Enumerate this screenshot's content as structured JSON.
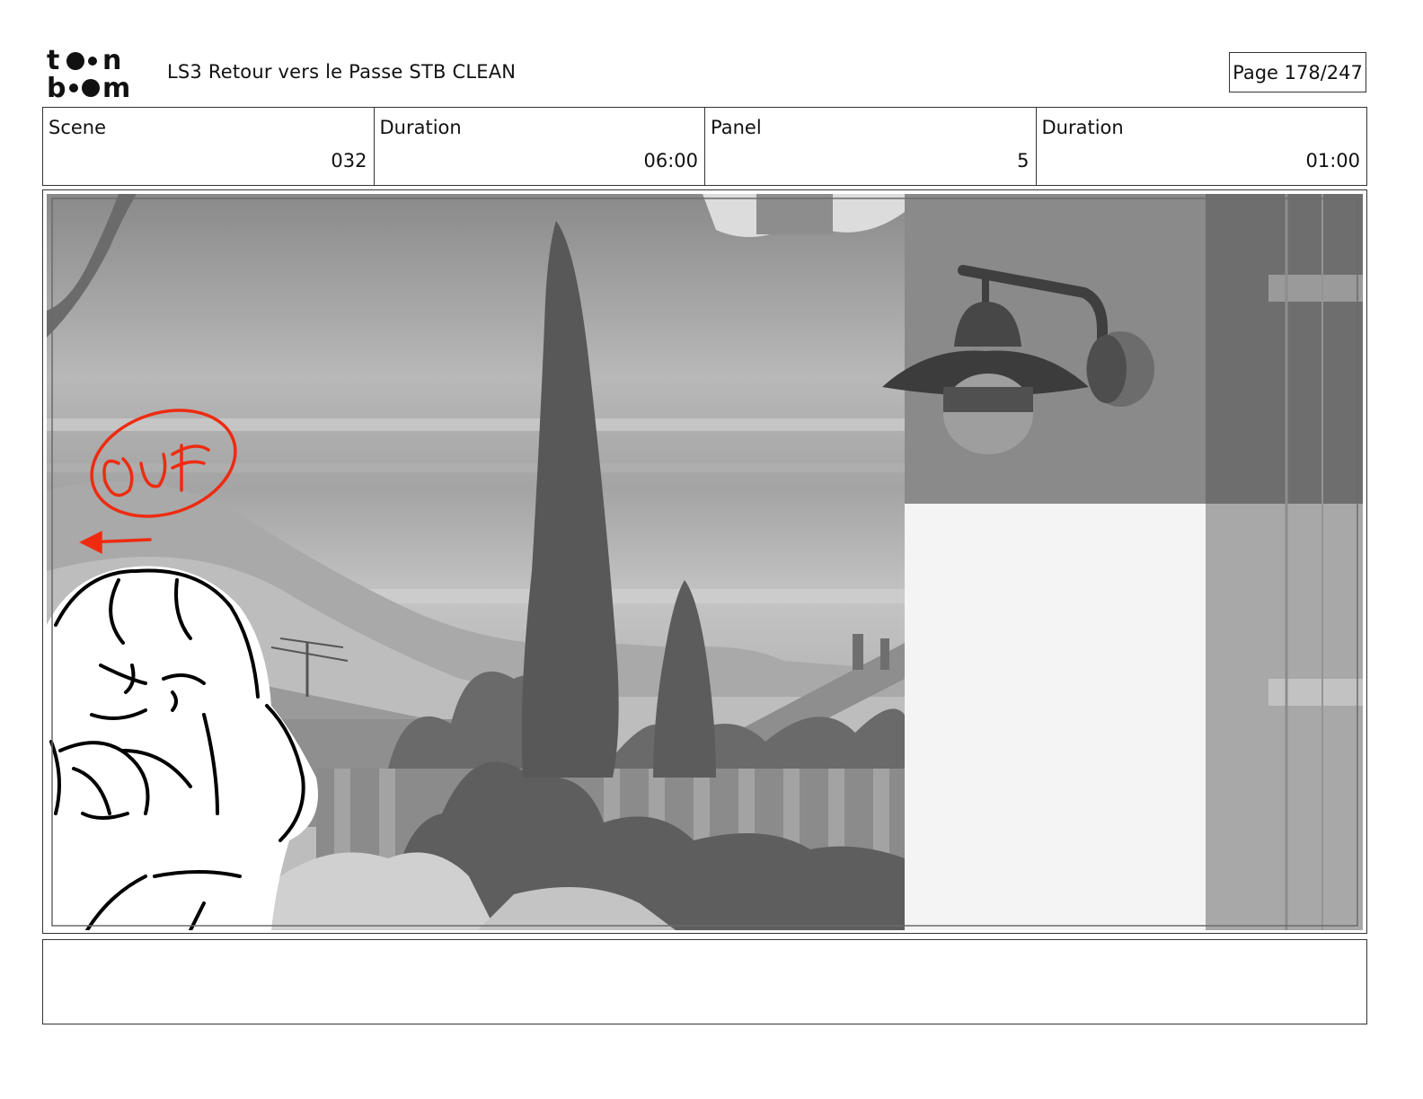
{
  "header": {
    "logo_text": "toon boom",
    "title": "LS3 Retour vers le Passe STB CLEAN",
    "page_label": "Page 178/247"
  },
  "info": {
    "scene_label": "Scene",
    "scene_value": "032",
    "scene_duration_label": "Duration",
    "scene_duration_value": "06:00",
    "panel_label": "Panel",
    "panel_value": "5",
    "panel_duration_label": "Duration",
    "panel_duration_value": "01:00"
  },
  "panel": {
    "annotation_text": "OUT",
    "annotation_color": "#ee2b10"
  },
  "notes": {
    "text": ""
  }
}
